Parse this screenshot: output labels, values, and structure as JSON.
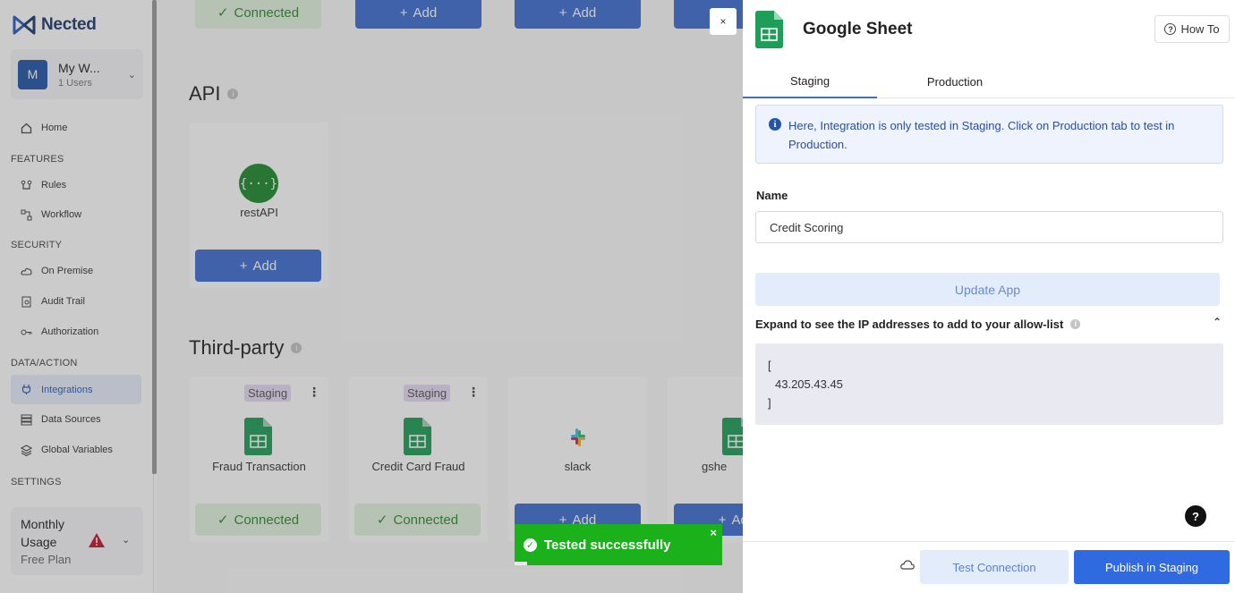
{
  "app": {
    "name": "Nected"
  },
  "workspace": {
    "initial": "M",
    "name": "My W...",
    "users": "1 Users"
  },
  "sidebar": {
    "home": "Home",
    "features_heading": "FEATURES",
    "rules": "Rules",
    "workflow": "Workflow",
    "security_heading": "SECURITY",
    "on_premise": "On Premise",
    "audit_trail": "Audit Trail",
    "authorization": "Authorization",
    "data_action_heading": "DATA/ACTION",
    "integrations": "Integrations",
    "data_sources": "Data Sources",
    "global_variables": "Global Variables",
    "settings_heading": "SETTINGS"
  },
  "plan": {
    "title": "Monthly Usage",
    "sub": "Free Plan"
  },
  "main": {
    "top_connected": "Connected",
    "add_label": "Add",
    "api_heading": "API",
    "rest_api_label": "restAPI",
    "third_party_heading": "Third-party",
    "staging_chip": "Staging",
    "cards": [
      {
        "label": "Fraud Transaction",
        "status": "Connected"
      },
      {
        "label": "Credit Card Fraud",
        "status": "Connected"
      },
      {
        "label": "slack",
        "status": "Add"
      },
      {
        "label": "gshe",
        "status": "Add"
      }
    ]
  },
  "toast": {
    "message": "Tested successfully",
    "close": "×"
  },
  "panel": {
    "title": "Google Sheet",
    "how_to": "How To",
    "close": "×",
    "tabs": [
      {
        "label": "Staging"
      },
      {
        "label": "Production"
      }
    ],
    "notice": "Here, Integration is only tested in Staging. Click on Production tab to test in Production.",
    "name_label": "Name",
    "name_value": "Credit Scoring",
    "update_button": "Update App",
    "expand_label": "Expand to see the IP addresses to add to your allow-list",
    "ip_open": "[",
    "ip_address": "43.205.43.45",
    "ip_close": "]",
    "help": "?",
    "test_button": "Test Connection",
    "publish_button": "Publish in Staging"
  },
  "colors": {
    "accent": "#2f6ae0",
    "success": "#1ab11a",
    "sheet_green": "#1e9e58"
  }
}
